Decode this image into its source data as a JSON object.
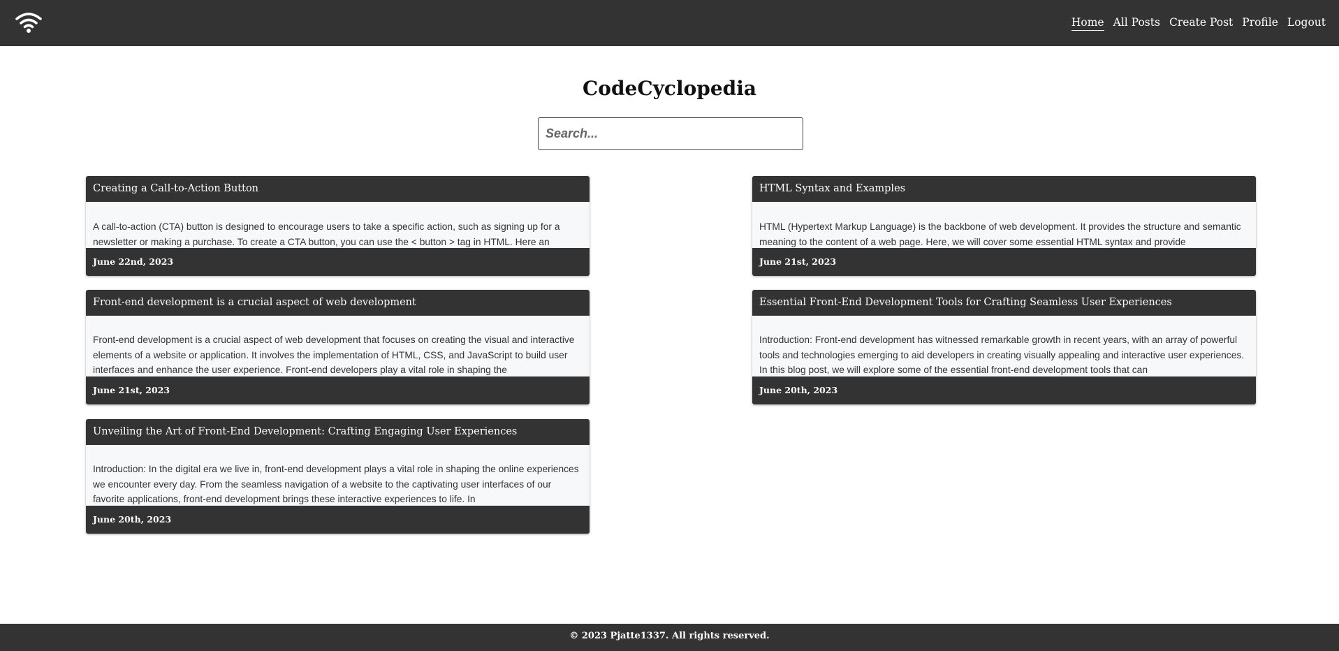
{
  "header": {
    "logo_icon": "wifi-icon",
    "nav": [
      "Home",
      "All Posts",
      "Create Post",
      "Profile",
      "Logout"
    ],
    "active": "Home"
  },
  "main": {
    "title": "CodeCyclopedia",
    "search_placeholder": "Search..."
  },
  "posts": [
    {
      "title": "Creating a Call-to-Action Button",
      "excerpt": "A call-to-action (CTA) button is designed to encourage users to take a specific action, such as signing up for a newsletter or making a purchase. To create a CTA button, you can use the < button > tag in HTML. Here an",
      "date": "June 22nd, 2023"
    },
    {
      "title": "HTML Syntax and Examples",
      "excerpt": "HTML (Hypertext Markup Language) is the backbone of web development. It provides the structure and semantic meaning to the content of a web page. Here, we will cover some essential HTML syntax and provide",
      "date": "June 21st, 2023"
    },
    {
      "title": "Front-end development is a crucial aspect of web development",
      "excerpt": "Front-end development is a crucial aspect of web development that focuses on creating the visual and interactive elements of a website or application. It involves the implementation of HTML, CSS, and JavaScript to build user interfaces and enhance the user experience. Front-end developers play a vital role in shaping the",
      "date": "June 21st, 2023"
    },
    {
      "title": "Essential Front-End Development Tools for Crafting Seamless User Experiences",
      "excerpt": "Introduction: Front-end development has witnessed remarkable growth in recent years, with an array of powerful tools and technologies emerging to aid developers in creating visually appealing and interactive user experiences. In this blog post, we will explore some of the essential front-end development tools that can",
      "date": "June 20th, 2023"
    },
    {
      "title": "Unveiling the Art of Front-End Development: Crafting Engaging User Experiences",
      "excerpt": "Introduction: In the digital era we live in, front-end development plays a vital role in shaping the online experiences we encounter every day. From the seamless navigation of a website to the captivating user interfaces of our favorite applications, front-end development brings these interactive experiences to life. In",
      "date": "June 20th, 2023"
    }
  ],
  "footer": {
    "text": "© 2023 Pjatte1337. All rights reserved."
  }
}
